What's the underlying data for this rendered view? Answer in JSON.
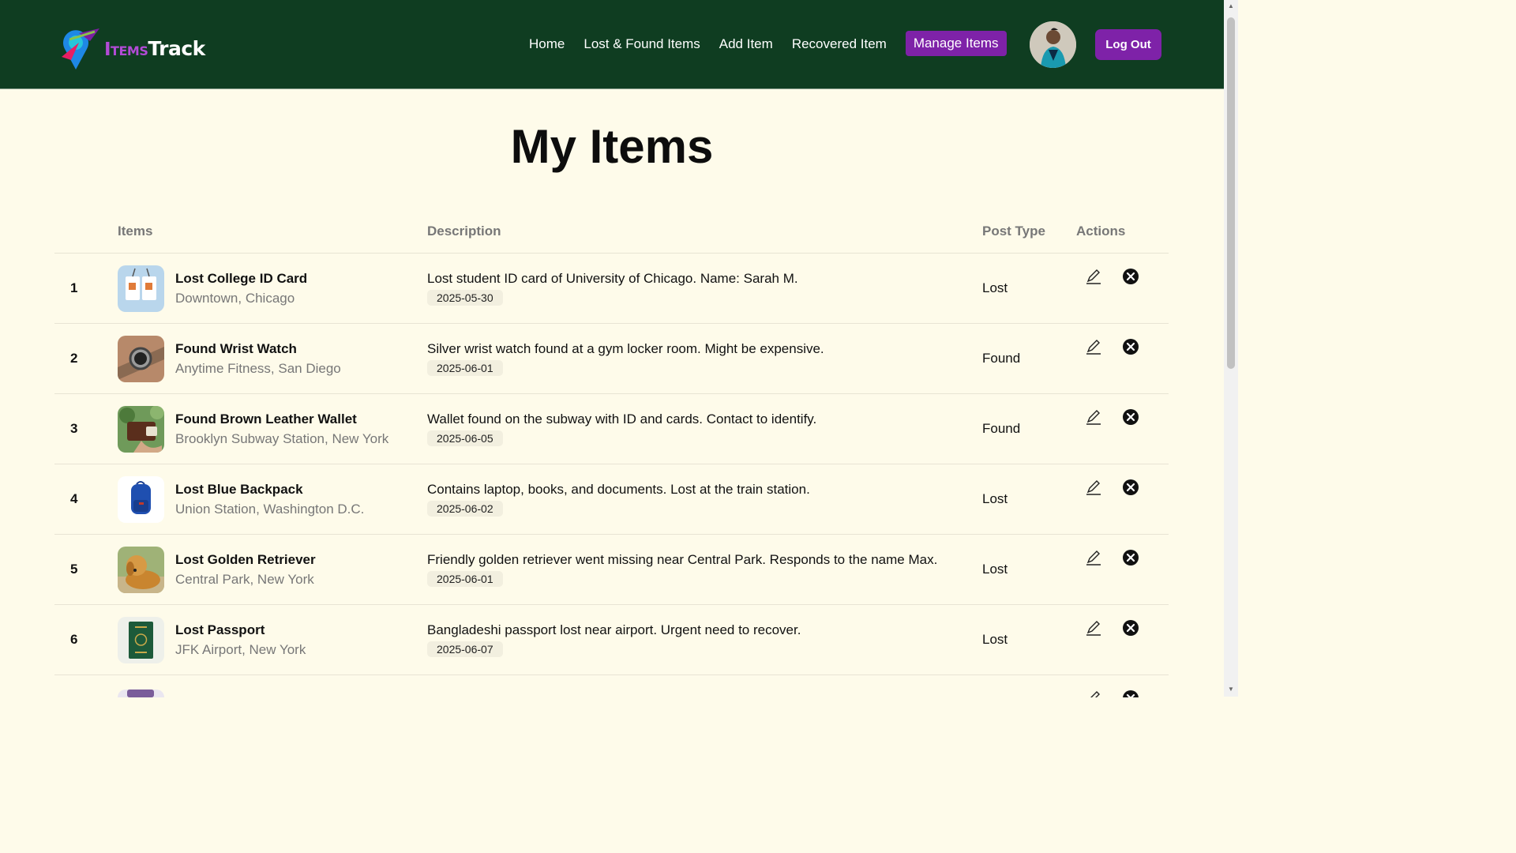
{
  "brand": {
    "part1": "Items",
    "part2": "Track"
  },
  "nav": {
    "links": [
      "Home",
      "Lost & Found Items",
      "Add Item",
      "Recovered Item"
    ],
    "active": "Manage Items",
    "logout": "Log Out"
  },
  "page": {
    "title": "My Items"
  },
  "table": {
    "headers": {
      "items": "Items",
      "description": "Description",
      "post_type": "Post Type",
      "actions": "Actions"
    },
    "rows": [
      {
        "num": "1",
        "name": "Lost College ID Card",
        "location": "Downtown, Chicago",
        "description": "Lost student ID card of University of Chicago. Name: Sarah M.",
        "date": "2025-05-30",
        "post_type": "Lost"
      },
      {
        "num": "2",
        "name": "Found Wrist Watch",
        "location": "Anytime Fitness, San Diego",
        "description": "Silver wrist watch found at a gym locker room. Might be expensive.",
        "date": "2025-06-01",
        "post_type": "Found"
      },
      {
        "num": "3",
        "name": "Found Brown Leather Wallet",
        "location": "Brooklyn Subway Station, New York",
        "description": "Wallet found on the subway with ID and cards. Contact to identify.",
        "date": "2025-06-05",
        "post_type": "Found"
      },
      {
        "num": "4",
        "name": "Lost Blue Backpack",
        "location": "Union Station, Washington D.C.",
        "description": "Contains laptop, books, and documents. Lost at the train station.",
        "date": "2025-06-02",
        "post_type": "Lost"
      },
      {
        "num": "5",
        "name": "Lost Golden Retriever",
        "location": "Central Park, New York",
        "description": "Friendly golden retriever went missing near Central Park. Responds to the name Max.",
        "date": "2025-06-01",
        "post_type": "Lost"
      },
      {
        "num": "6",
        "name": "Lost Passport",
        "location": "JFK Airport, New York",
        "description": "Bangladeshi passport lost near airport. Urgent need to recover.",
        "date": "2025-06-07",
        "post_type": "Lost"
      }
    ]
  },
  "icons": {
    "edit": "pencil-icon",
    "delete": "close-circle-icon"
  },
  "colors": {
    "navbar": "#0f3d21",
    "accent": "#7e22a8",
    "background": "#fefbea"
  }
}
